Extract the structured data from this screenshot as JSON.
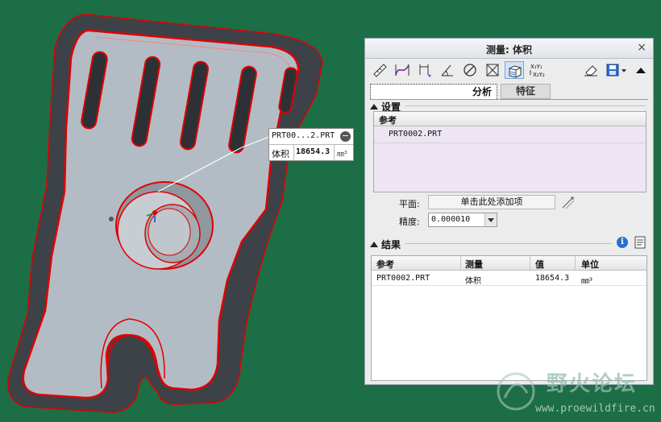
{
  "callout": {
    "name": "PRT00...2.PRT",
    "label": "体积",
    "value": "18654.3",
    "unit": "㎜³"
  },
  "dialog": {
    "title": "测量: 体积",
    "close": "×",
    "toolbar": [
      "ruler-icon",
      "curve-length-icon",
      "distance-icon",
      "angle-icon",
      "diameter-icon",
      "area-icon",
      "volume-icon",
      "transform-icon",
      "eraser-icon",
      "save-icon",
      "collapse-icon"
    ],
    "tabs": [
      "分析",
      "特征"
    ],
    "setup": {
      "header": "设置",
      "ref_header": "参考",
      "ref_item": "PRT0002.PRT",
      "plane_label": "平面:",
      "plane_value": "单击此处添加项",
      "precision_label": "精度:",
      "precision_value": "0.000010"
    },
    "results": {
      "header": "结果",
      "columns": [
        "参考",
        "测量",
        "值",
        "单位"
      ],
      "rows": [
        {
          "ref": "PRT0002.PRT",
          "measure": "体积",
          "value": "18654.3",
          "unit": "㎜³"
        }
      ]
    }
  },
  "watermark": {
    "text": "野火论坛",
    "url": "www.proewildfire.cn"
  },
  "colors": {
    "background": "#1c6e46",
    "part_face": "#b3bcc4",
    "part_side": "#3d4248",
    "edge": "#e00000",
    "accent": "#2a6fd0"
  }
}
